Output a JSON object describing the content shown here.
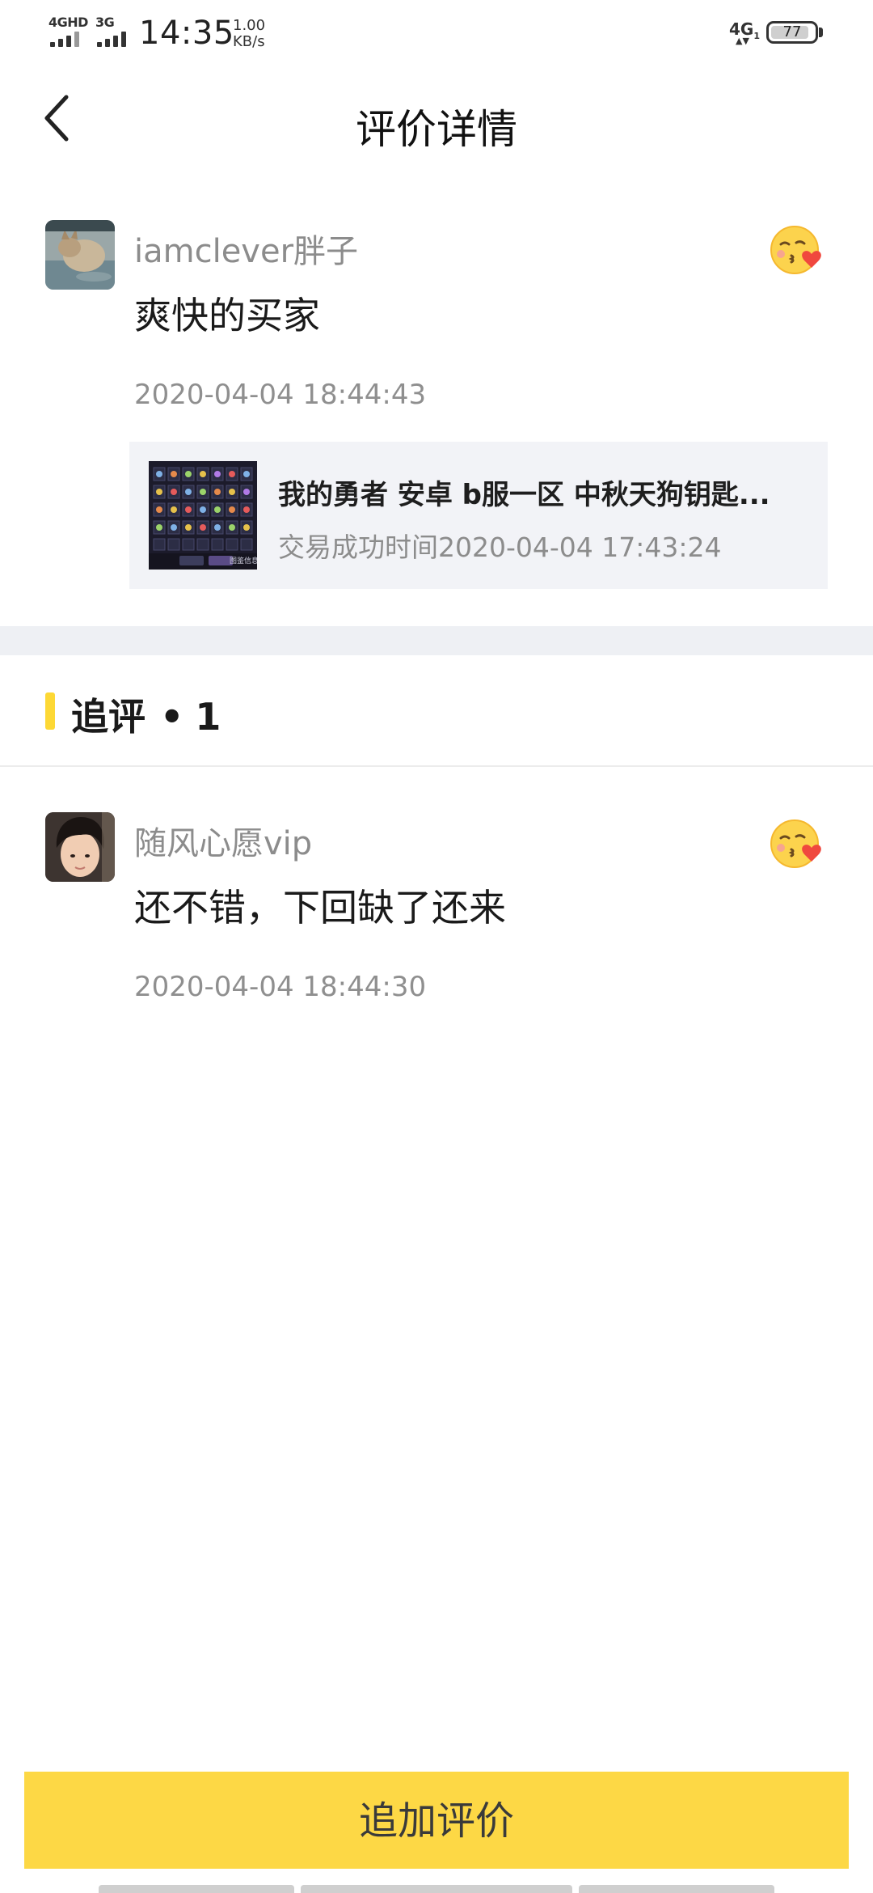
{
  "status_bar": {
    "signal_1": "4GHD",
    "signal_2": "3G",
    "time": "14:35",
    "net_speed_value": "1.00",
    "net_speed_unit": "KB/s",
    "network_right": "4G",
    "network_right_sub": "1",
    "battery_level": "77"
  },
  "header": {
    "title": "评价详情"
  },
  "main_review": {
    "username": "iamclever胖子",
    "comment": "爽快的买家",
    "timestamp": "2020-04-04 18:44:43",
    "emoji_icon": "kiss-heart-emoji-icon",
    "order": {
      "title": "我的勇者 安卓 b服一区  中秋天狗钥匙...",
      "time_label": "交易成功时间",
      "time_value": "2020-04-04 17:43:24",
      "thumb_caption": "图鉴信息"
    }
  },
  "followup_section": {
    "title": "追评",
    "separator": "•",
    "count": "1"
  },
  "followup_review": {
    "username": "随风心愿vip",
    "comment": "还不错，下回缺了还来",
    "timestamp": "2020-04-04 18:44:30",
    "emoji_icon": "kiss-heart-emoji-icon"
  },
  "footer": {
    "add_review_label": "追加评价"
  },
  "colors": {
    "accent_yellow": "#fdd845",
    "username_gray": "#8c8c8c",
    "section_gap": "#eef0f4",
    "order_bg": "#f2f3f7"
  }
}
